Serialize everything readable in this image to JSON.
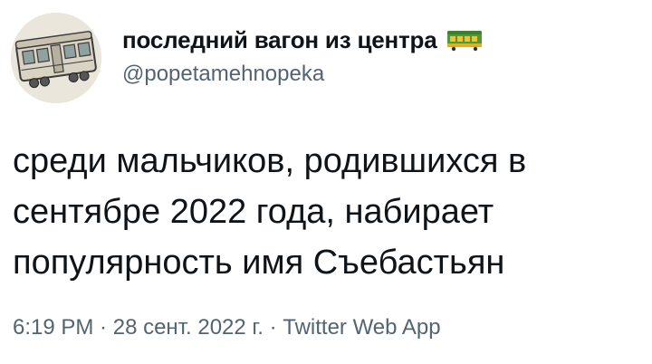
{
  "author": {
    "display_name": "последний вагон из центра",
    "name_emoji": "train-car-emoji",
    "handle": "@popetamehnopeka"
  },
  "tweet": {
    "text": "среди мальчиков, родившихся в\nсентябре 2022 года, набирает\nпопулярность имя Съебастьян"
  },
  "meta": {
    "time": "6:19 PM",
    "separator1": " · ",
    "date": "28 сент. 2022 г.",
    "separator2": " · ",
    "source": "Twitter Web App"
  },
  "colors": {
    "text": "#0f1419",
    "secondary": "#536471",
    "emoji_green": "#4a9a3c",
    "emoji_yellow": "#f2c230"
  }
}
